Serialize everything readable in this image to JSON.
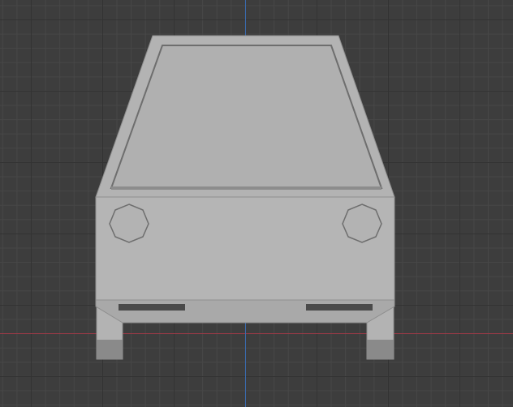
{
  "viewport": {
    "background": "#3d3d3d",
    "grid_minor_color": "#474747",
    "grid_major_color": "#333333",
    "x_axis_color": "#9a3a46",
    "y_axis_color": "#3a6bb0"
  },
  "model": {
    "type": "car-front-view",
    "body_color": "#b3b3b3",
    "windshield_color": "#b0b0b0",
    "bumper_color": "#a8a8a8",
    "shadow_color": "#7a7a7a",
    "vent_color": "#4a4a4a",
    "tire_color": "#8a8a8a"
  }
}
